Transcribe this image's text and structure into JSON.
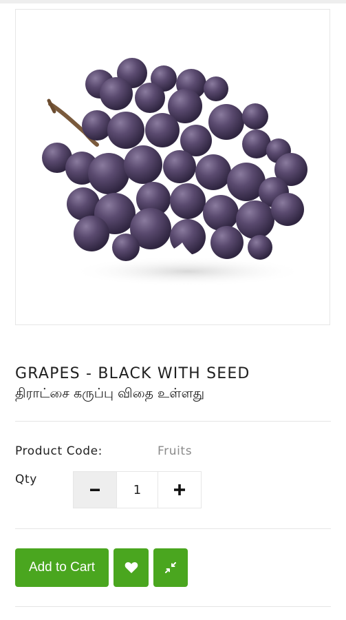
{
  "product": {
    "title_en": "GRAPES - BLACK WITH SEED",
    "title_ta": "திராட்சை கருப்பு விதை உள்ளது",
    "image_icon": "grapes-image"
  },
  "details": {
    "code_label": "Product Code:",
    "code_value": "Fruits",
    "qty_label": "Qty"
  },
  "qty": {
    "minus_icon": "minus-icon",
    "value": "1",
    "plus_icon": "plus-icon"
  },
  "actions": {
    "add_to_cart_label": "Add to Cart",
    "wishlist_icon": "heart-icon",
    "compare_icon": "compress-icon"
  },
  "colors": {
    "accent": "#4aa61f",
    "muted_text": "#8a8a8a",
    "divider": "#e5e5e5"
  }
}
